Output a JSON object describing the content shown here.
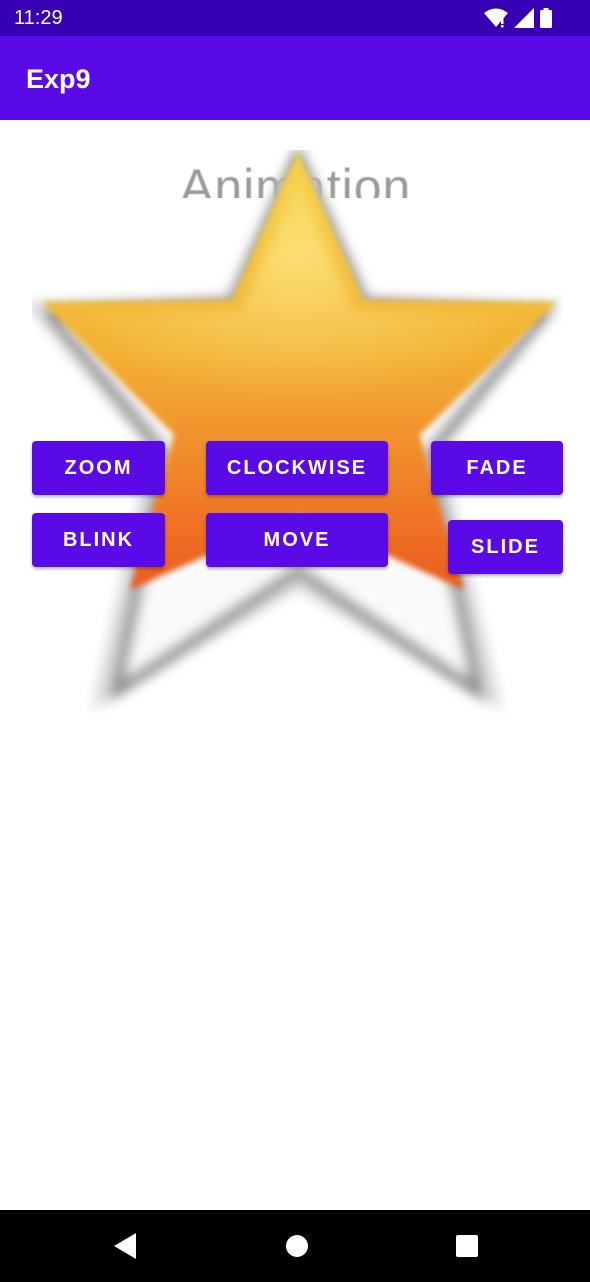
{
  "status_bar": {
    "time": "11:29",
    "icons": [
      "wifi-icon",
      "signal-icon",
      "battery-icon"
    ]
  },
  "app_bar": {
    "title": "Exp9",
    "color": "#5a0ae6"
  },
  "content": {
    "header_text": "Animation",
    "image": "star-icon",
    "buttons": {
      "zoom": "ZOOM",
      "clockwise": "CLOCKWISE",
      "fade": "FADE",
      "blink": "BLINK",
      "move": "MOVE",
      "slide": "SLIDE"
    }
  },
  "nav_bar": {
    "icons": [
      "back-icon",
      "home-icon",
      "recents-icon"
    ]
  }
}
